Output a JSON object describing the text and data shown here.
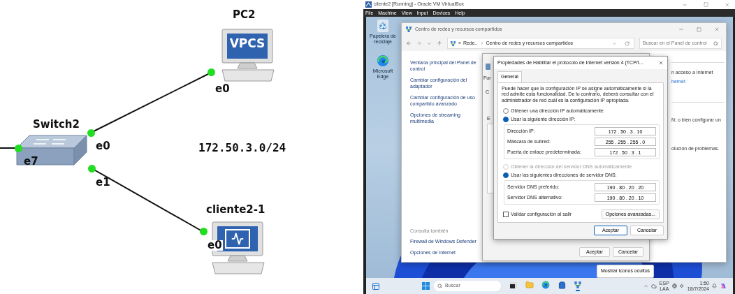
{
  "topology": {
    "pc": {
      "name": "PC2",
      "screen_text": "VPCS",
      "port": "e0"
    },
    "switch": {
      "name": "Switch2",
      "ports": [
        "e0",
        "e7",
        "e1"
      ]
    },
    "client": {
      "name": "cliente2-1",
      "port": "e0"
    },
    "subnet_label": "172.50.3.0/24"
  },
  "virtualbox": {
    "title": "cliente2 [Running] - Oracle VM VirtualBox",
    "menu": [
      "File",
      "Machine",
      "View",
      "Input",
      "Devices",
      "Help"
    ],
    "desktop_icons": [
      {
        "kind": "recycle",
        "label": "Papelera de reciclaje"
      },
      {
        "kind": "edge",
        "label": "Microsoft Edge"
      }
    ],
    "network_center": {
      "title": "Centro de redes y recursos compartidos",
      "address_prefix": "«",
      "crumbs": [
        "Rede..",
        "Centro de redes y recursos compartidos"
      ],
      "search_placeholder": "Buscar en el Panel de control",
      "sidebar_links": [
        "Ventana principal del Panel de control",
        "Cambiar configuración del adaptador",
        "Cambiar configuración de uso compartido avanzado",
        "Opciones de streaming multimedia"
      ],
      "see_also_heading": "Consulta también",
      "see_also_links": [
        "Firewall de Windows Defender",
        "Opciones de Internet"
      ],
      "fragments": [
        {
          "kind": "text",
          "text": "n acceso a Internet"
        },
        {
          "kind": "link",
          "text": "hernet"
        },
        {
          "kind": "text",
          "text": "N; o bien configurar un"
        },
        {
          "kind": "text",
          "text": "olución de problemas."
        }
      ]
    },
    "ethernet_dialog": {
      "fragments": [
        "Fur",
        "C",
        "E"
      ],
      "buttons": [
        "Aceptar",
        "Cancelar"
      ]
    },
    "ipv4_dialog": {
      "title": "Propiedades de Habilitar el protocolo de Internet versión 4 (TCP/I...",
      "tabs": [
        {
          "label": "General",
          "selected": true
        }
      ],
      "intro": "Puede hacer que la configuración IP se asigne automáticamente si la red admite esta funcionalidad. De lo contrario, deberá consultar con el administrador de red cuál es la configuración IP apropiada.",
      "ip_options": [
        {
          "label": "Obtener una dirección IP automáticamente",
          "selected": false,
          "disabled": false
        },
        {
          "label": "Usar la siguiente dirección IP:",
          "selected": true,
          "disabled": false
        }
      ],
      "ip_fields": [
        {
          "label": "Dirección IP:",
          "value": "172 . 50 . 3 . 10"
        },
        {
          "label": "Máscara de subred:",
          "value": "255 . 255 . 255 . 0"
        },
        {
          "label": "Puerta de enlace predeterminada:",
          "value": "172 . 50 . 3 . 1"
        }
      ],
      "dns_options": [
        {
          "label": "Obtener la dirección del servidor DNS automáticamente",
          "selected": false,
          "disabled": true
        },
        {
          "label": "Usar las siguientes direcciones de servidor DNS:",
          "selected": true,
          "disabled": false
        }
      ],
      "dns_fields": [
        {
          "label": "Servidor DNS preferido:",
          "value": "190 . 80 . 20 . 20"
        },
        {
          "label": "Servidor DNS alternativo:",
          "value": "190 . 80 . 20 . 10"
        }
      ],
      "validate": {
        "label": "Validar configuración al salir",
        "checked": false
      },
      "advanced_button": "Opciones avanzadas...",
      "buttons": [
        {
          "label": "Aceptar",
          "default": true
        },
        {
          "label": "Cancelar",
          "default": false
        }
      ]
    },
    "tooltip": "Mostrar iconos ocultos",
    "taskbar": {
      "search_placeholder": "Buscar",
      "apps": [
        {
          "kind": "taskview",
          "active": false
        },
        {
          "kind": "explorer",
          "active": false
        },
        {
          "kind": "edge",
          "active": false
        },
        {
          "kind": "store",
          "active": false
        },
        {
          "kind": "network",
          "active": true
        }
      ],
      "language": [
        "ESP",
        "LAA"
      ],
      "time": "1:50",
      "date": "18/7/2024"
    }
  }
}
